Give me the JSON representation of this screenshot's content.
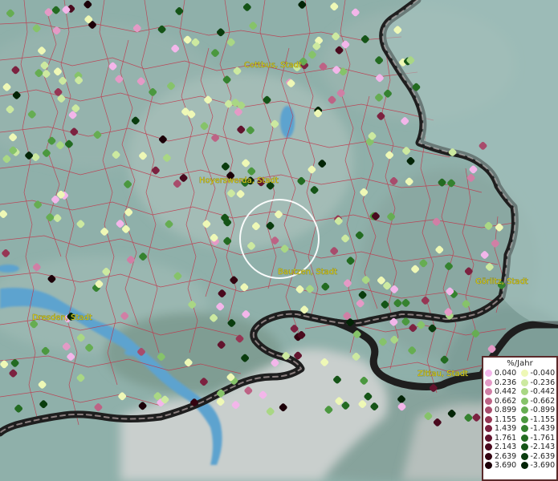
{
  "cities": [
    {
      "id": "cottbus",
      "label": "Cottbus, Stadt"
    },
    {
      "id": "hoyerswerda",
      "label": "Hoyerswerda, Stadt"
    },
    {
      "id": "bautzen",
      "label": "Bautzen, Stadt"
    },
    {
      "id": "goerlitz",
      "label": "Görlitz, Stadt"
    },
    {
      "id": "dresden",
      "label": "Dresden, Stadt"
    },
    {
      "id": "zittau",
      "label": "Zittau, Stadt"
    }
  ],
  "legend": {
    "title": "%/Jahr",
    "positive": [
      {
        "label": "0.040",
        "color": "#f3b6ea"
      },
      {
        "label": "0.236",
        "color": "#e49ac6"
      },
      {
        "label": "0.442",
        "color": "#d07fa5"
      },
      {
        "label": "0.662",
        "color": "#bd6385"
      },
      {
        "label": "0.899",
        "color": "#a84c6c"
      },
      {
        "label": "1.155",
        "color": "#963654"
      },
      {
        "label": "1.439",
        "color": "#7c2240"
      },
      {
        "label": "1.761",
        "color": "#62132d"
      },
      {
        "label": "2.143",
        "color": "#4a0a1e"
      },
      {
        "label": "2.639",
        "color": "#330411"
      },
      {
        "label": "3.690",
        "color": "#1c0008"
      }
    ],
    "negative": [
      {
        "label": "-0.040",
        "color": "#eef8b6"
      },
      {
        "label": "-0.236",
        "color": "#cce9a0"
      },
      {
        "label": "-0.442",
        "color": "#a9d784"
      },
      {
        "label": "-0.662",
        "color": "#86c36a"
      },
      {
        "label": "-0.899",
        "color": "#66ad52"
      },
      {
        "label": "-1.155",
        "color": "#4b983f"
      },
      {
        "label": "-1.439",
        "color": "#35822f"
      },
      {
        "label": "-1.761",
        "color": "#236b21"
      },
      {
        "label": "-2.143",
        "color": "#155417"
      },
      {
        "label": "-2.639",
        "color": "#0a3c0e"
      },
      {
        "label": "-3.690",
        "color": "#032406"
      }
    ]
  }
}
